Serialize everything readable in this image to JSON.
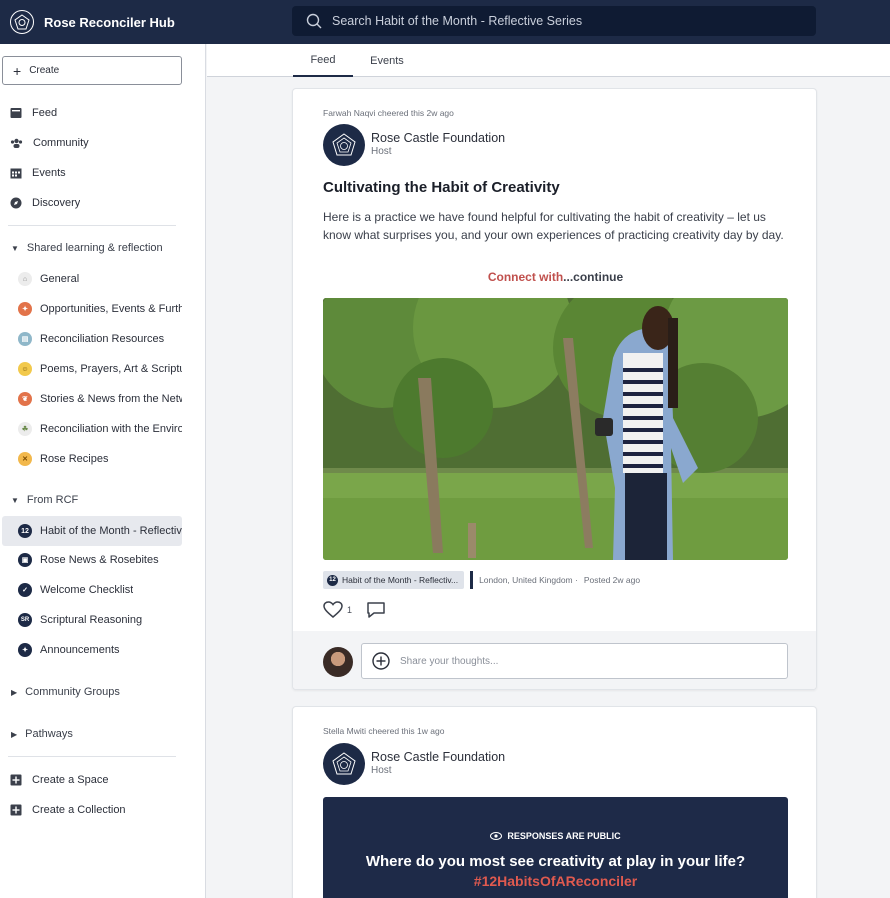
{
  "app": {
    "name": "Rose Reconciler Hub",
    "search_placeholder": "Search Habit of the Month - Reflective Series"
  },
  "sidebar": {
    "create_label": "Create",
    "nav": [
      {
        "label": "Feed",
        "icon": "feed-icon"
      },
      {
        "label": "Community",
        "icon": "community-icon"
      },
      {
        "label": "Events",
        "icon": "calendar-icon"
      },
      {
        "label": "Discovery",
        "icon": "compass-icon"
      }
    ],
    "groups": [
      {
        "label": "Shared learning & reflection",
        "items": [
          {
            "label": "General",
            "color": "#e9e9e9",
            "glyph": "⌂"
          },
          {
            "label": "Opportunities, Events & Further",
            "color": "#e2734a",
            "glyph": "✦"
          },
          {
            "label": "Reconciliation Resources",
            "color": "#8fb7c9",
            "glyph": "▤"
          },
          {
            "label": "Poems, Prayers, Art & Scripture",
            "color": "#f2c94c",
            "glyph": "☺"
          },
          {
            "label": "Stories & News from the Network",
            "color": "#e2734a",
            "glyph": "❦"
          },
          {
            "label": "Reconciliation with the Environment",
            "color": "#e9e9e9",
            "glyph": "☘"
          },
          {
            "label": "Rose Recipes",
            "color": "#f2b84c",
            "glyph": "✕"
          }
        ]
      },
      {
        "label": "From RCF",
        "items": [
          {
            "label": "Habit of the Month - Reflective Series",
            "color": "#1d2a46",
            "glyph": "12",
            "active": true
          },
          {
            "label": "Rose News & Rosebites",
            "color": "#1d2a46",
            "glyph": "▣"
          },
          {
            "label": "Welcome Checklist",
            "color": "#1d2a46",
            "glyph": "✓"
          },
          {
            "label": "Scriptural Reasoning",
            "color": "#1d2a46",
            "glyph": "SR"
          },
          {
            "label": "Announcements",
            "color": "#1d2a46",
            "glyph": "✦"
          }
        ]
      }
    ],
    "collapsed_groups": [
      "Community Groups",
      "Pathways"
    ],
    "footer": [
      "Create a Space",
      "Create a Collection"
    ]
  },
  "tabs": [
    {
      "label": "Feed",
      "active": true
    },
    {
      "label": "Events",
      "active": false
    }
  ],
  "posts": [
    {
      "cheer": "Farwah Naqvi cheered this 2w ago",
      "host_name": "Rose Castle Foundation",
      "host_role": "Host",
      "title": "Cultivating the Habit of Creativity",
      "body": "Here is a practice we have found helpful for cultivating the habit of creativity – let us know what surprises you, and your own experiences of practicing creativity day by day.",
      "continue_link": "Connect with",
      "continue_more": "...continue",
      "space_chip": "Habit of the Month - Reflectiv...",
      "location": "London, United Kingdom ·",
      "posted": "Posted 2w ago",
      "likes": "1",
      "comment_placeholder": "Share your thoughts..."
    },
    {
      "cheer": "Stella Mwiti cheered this 1w ago",
      "host_name": "Rose Castle Foundation",
      "host_role": "Host",
      "banner_public": "RESPONSES ARE PUBLIC",
      "banner_question": "Where do you most see creativity at play in your life?",
      "banner_tag": "#12HabitsOfAReconciler"
    }
  ]
}
